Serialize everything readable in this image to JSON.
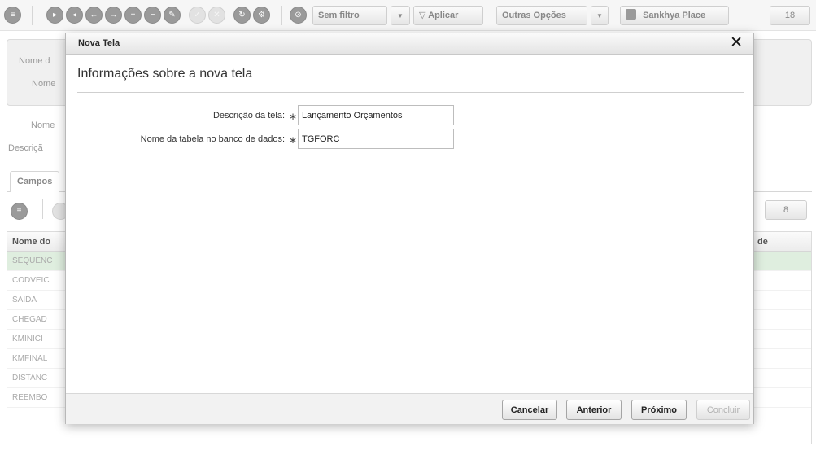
{
  "toolbar": {
    "filter_label": "Sem filtro",
    "apply_label": "Aplicar",
    "more_options_label": "Outras Opções",
    "place_label": "Sankhya Place",
    "record_count": "18"
  },
  "background": {
    "filter_label_1": "Nome d",
    "filter_label_2": "Nome",
    "field_label_name": "Nome",
    "field_label_description": "Descriçã",
    "tab_fields": "Campos",
    "grid_count": "8",
    "grid_header_first": "Nome do",
    "grid_header_right": "de",
    "rows": [
      "SEQUENC",
      "CODVEIC",
      "SAIDA",
      "CHEGAD",
      "KMINICI",
      "KMFINAL",
      "DISTANC",
      "REEMBO"
    ]
  },
  "dialog": {
    "title": "Nova Tela",
    "close_symbol": "✕",
    "heading": "Informações sobre a nova tela",
    "required_mark": "∗",
    "fields": {
      "description_label": "Descrição da tela:",
      "description_value": "Lançamento Orçamentos",
      "table_label": "Nome da tabela no banco de dados:",
      "table_value": "TGFORC"
    },
    "buttons": {
      "cancel": "Cancelar",
      "previous": "Anterior",
      "next": "Próximo",
      "finish": "Concluir"
    }
  }
}
